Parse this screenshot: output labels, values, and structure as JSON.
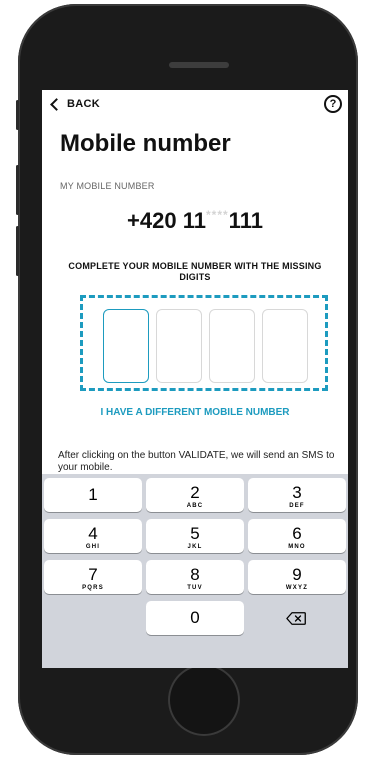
{
  "header": {
    "back_label": "BACK",
    "help_icon": "question-circle-icon"
  },
  "page": {
    "title": "Mobile number",
    "section_label": "MY MOBILE NUMBER",
    "number_prefix": "+420 11",
    "number_mask": "****",
    "number_suffix": "111",
    "instruction": "COMPLETE YOUR MOBILE NUMBER WITH THE MISSING DIGITS",
    "digit_count": 4,
    "alt_link": "I HAVE A DIFFERENT MOBILE NUMBER",
    "note": "After clicking on the button VALIDATE, we will send an SMS to your mobile."
  },
  "keyboard": {
    "keys": [
      {
        "num": "1",
        "letters": ""
      },
      {
        "num": "2",
        "letters": "ABC"
      },
      {
        "num": "3",
        "letters": "DEF"
      },
      {
        "num": "4",
        "letters": "GHI"
      },
      {
        "num": "5",
        "letters": "JKL"
      },
      {
        "num": "6",
        "letters": "MNO"
      },
      {
        "num": "7",
        "letters": "PQRS"
      },
      {
        "num": "8",
        "letters": "TUV"
      },
      {
        "num": "9",
        "letters": "WXYZ"
      },
      {
        "num": "0",
        "letters": ""
      }
    ],
    "backspace_icon": "backspace-icon"
  },
  "colors": {
    "accent": "#1d9bbf",
    "keyboard_bg": "#d1d4db",
    "phone_body": "#1b1b1b"
  }
}
